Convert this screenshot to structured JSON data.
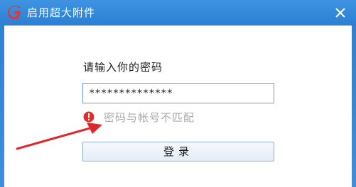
{
  "window": {
    "title": "启用超大附件",
    "logo_icon": "app-logo-icon",
    "close_icon": "close-icon",
    "titlebar_color": "#2a7fd3"
  },
  "form": {
    "prompt": "请输入你的密码",
    "password_value": "**************",
    "error_icon": "error-icon",
    "error_message": "密码与帐号不匹配",
    "error_icon_color": "#d9302c",
    "login_button_label": "登录"
  },
  "annotation": {
    "arrow_color": "#e0262a",
    "arrow_icon": "red-arrow-annotation"
  }
}
